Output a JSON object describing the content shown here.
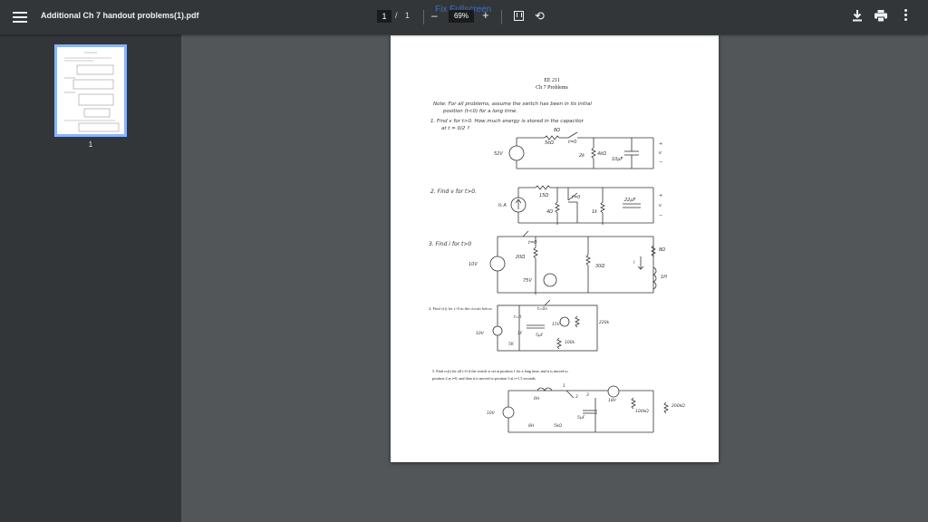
{
  "toolbar": {
    "title": "Additional Ch 7 handout problems(1).pdf",
    "current_page": "1",
    "page_separator": "/",
    "total_pages": "1",
    "zoom": "69%",
    "zoom_out_symbol": "–",
    "zoom_in_symbol": "+",
    "watermark": "Fix Fullscreen",
    "icons": [
      "menu-icon",
      "fit-page-icon",
      "rotate-icon",
      "download-icon",
      "print-icon",
      "more-vert-icon"
    ]
  },
  "sidebar": {
    "thumbnail_label": "1"
  },
  "document": {
    "course": "EE 211",
    "heading": "Ch 7 Problems",
    "note_1": "Note: For all problems, assume the switch has been in its initial",
    "note_2": "position (t<0) for a long time.",
    "p1_1": "1. Find v for t>0. How much energy is stored in the capacitor",
    "p1_2": "at t = 0/2 ?",
    "p1_labels": [
      "8Ω",
      "t=0",
      "52V",
      "2k",
      "10μF",
      "+",
      "v",
      "−",
      "4kΩ",
      "5kΩ"
    ],
    "p2_text": "2. Find v for t>0.",
    "p2_labels": [
      "⅙ A",
      "15Ω",
      "t=0",
      "4Ω",
      "1k",
      "22μF",
      "+",
      "v",
      "−"
    ],
    "p3_text": "3. Find i for t>0",
    "p3_labels": [
      "t=0",
      "10V",
      "20Ω",
      "30Ω",
      "75V",
      "8Ω",
      "i",
      "1H"
    ],
    "p4_text": "4. Find v(t) for t>0 in the circuit below.",
    "p4_labels": [
      "t=0",
      "15V",
      "220k",
      "10V",
      "1F",
      "5μF",
      "100k",
      "5K",
      "t=0s"
    ],
    "p5_text_1": "5. Find vc(t) for all t>0 if the switch is set at position 1 for a long time, and it is moved to",
    "p5_text_2": "position 2 at t=0, and then it is moved to position 3 at t=1.5 seconds.",
    "p5_labels": [
      "6H",
      "1",
      "2",
      "3",
      "18V",
      "10V",
      "5μF",
      "100kΩ",
      "200kΩ",
      "8H",
      "5kΩ"
    ]
  },
  "colors": {
    "toolbar_bg": "#323639",
    "viewer_bg": "#525659",
    "thumb_border": "#8ab4f8"
  }
}
